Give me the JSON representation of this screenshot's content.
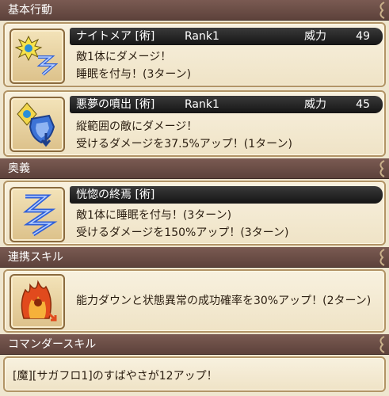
{
  "sections": {
    "basic": "基本行動",
    "ougi": "奥義",
    "link": "連携スキル",
    "commander": "コマンダースキル"
  },
  "skills": [
    {
      "name": "ナイトメア [術]",
      "rank": "Rank1",
      "power_label": "威力",
      "power": "49",
      "lines": [
        "敵1体にダメージ！",
        "睡眠を付与！(3ターン)"
      ],
      "icon": "lightning-burst-icon"
    },
    {
      "name": "悪夢の噴出 [術]",
      "rank": "Rank1",
      "power_label": "威力",
      "power": "45",
      "lines": [
        "縦範囲の敵にダメージ！",
        "受けるダメージを37.5%アップ！(1ターン)"
      ],
      "icon": "shield-debuff-icon"
    }
  ],
  "ougi": {
    "name": "恍惚の終焉 [術]",
    "lines": [
      "敵1体に睡眠を付与！(3ターン)",
      "受けるダメージを150%アップ！(3ターン)"
    ],
    "icon": "sleep-zz-icon"
  },
  "link_skill": {
    "text": "能力ダウンと状態異常の成功確率を30%アップ！(2ターン)",
    "icon": "flame-hand-icon"
  },
  "commander_skill": {
    "text": "[魔][サガフロ1]のすばやさが12アップ！"
  },
  "colors": {
    "header": "#6b4d45",
    "bar": "#1e1e1e",
    "card_border": "#b29466",
    "background": "#efe6cf"
  }
}
